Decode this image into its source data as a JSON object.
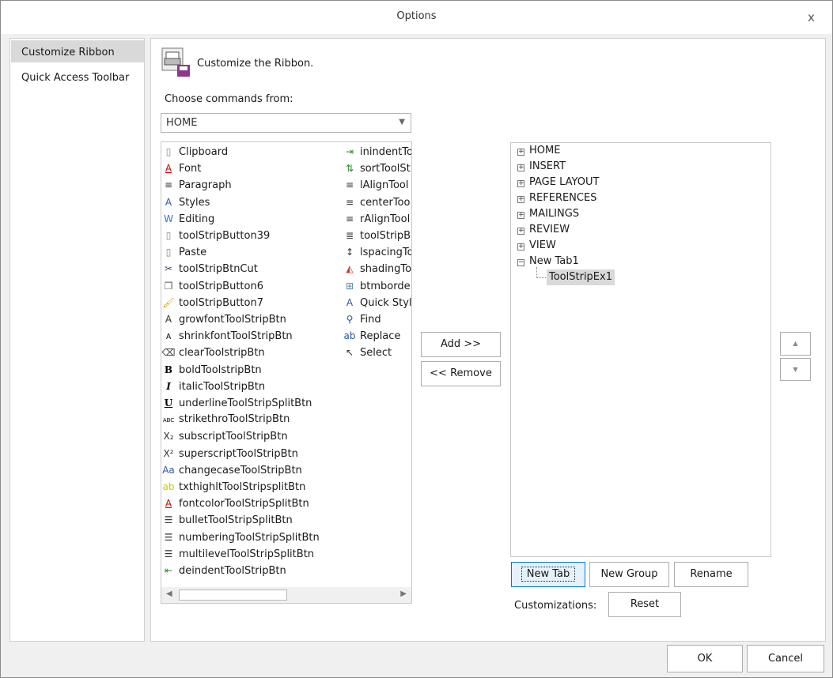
{
  "window": {
    "title": "Options",
    "close": "x"
  },
  "sidebar": {
    "items": [
      {
        "label": "Customize Ribbon",
        "selected": true
      },
      {
        "label": "Quick Access Toolbar",
        "selected": false
      }
    ]
  },
  "header": {
    "title": "Customize the Ribbon.",
    "icon": "customize-ribbon-icon"
  },
  "choose": {
    "label": "Choose commands from:",
    "value": "HOME"
  },
  "commands_col1": [
    {
      "label": "Clipboard",
      "icon": "clipboard"
    },
    {
      "label": "Font",
      "icon": "font"
    },
    {
      "label": "Paragraph",
      "icon": "paragraph"
    },
    {
      "label": "Styles",
      "icon": "styles"
    },
    {
      "label": "Editing",
      "icon": "editing"
    },
    {
      "label": "toolStripButton39",
      "icon": "clipboard"
    },
    {
      "label": "Paste",
      "icon": "clipboard"
    },
    {
      "label": "toolStripBtnCut",
      "icon": "cut"
    },
    {
      "label": "toolStripButton6",
      "icon": "copy"
    },
    {
      "label": "toolStripButton7",
      "icon": "format-painter"
    },
    {
      "label": "growfontToolStripBtn",
      "icon": "grow-font"
    },
    {
      "label": "shrinkfontToolStripBtn",
      "icon": "shrink-font"
    },
    {
      "label": "clearToolstripBtn",
      "icon": "clear-format"
    },
    {
      "label": "boldToolstripBtn",
      "icon": "bold"
    },
    {
      "label": "italicToolStripBtn",
      "icon": "italic"
    },
    {
      "label": "underlineToolStripSplitBtn",
      "icon": "underline"
    },
    {
      "label": "strikethroToolStripBtn",
      "icon": "strikethrough"
    },
    {
      "label": "subscriptToolStripBtn",
      "icon": "subscript"
    },
    {
      "label": "superscriptToolStripBtn",
      "icon": "superscript"
    },
    {
      "label": "changecaseToolStripBtn",
      "icon": "change-case"
    },
    {
      "label": "txthighltToolStripsplitBtn",
      "icon": "highlight"
    },
    {
      "label": "fontcolorToolStripSplitBtn",
      "icon": "font-color"
    },
    {
      "label": "bulletToolStripSplitBtn",
      "icon": "bullets"
    },
    {
      "label": "numberingToolStripSplitBtn",
      "icon": "numbering"
    },
    {
      "label": "multilevelToolStripSplitBtn",
      "icon": "multilevel"
    },
    {
      "label": "deindentToolStripBtn",
      "icon": "decrease-indent"
    }
  ],
  "commands_col2": [
    {
      "label": "inindentTo",
      "icon": "increase-indent"
    },
    {
      "label": "sortToolSt",
      "icon": "sort"
    },
    {
      "label": "lAlignTool",
      "icon": "align-left"
    },
    {
      "label": "centerToo",
      "icon": "align-center"
    },
    {
      "label": "rAlignTool",
      "icon": "align-right"
    },
    {
      "label": "toolStripB",
      "icon": "justify"
    },
    {
      "label": "lspacingTo",
      "icon": "line-spacing"
    },
    {
      "label": "shadingTo",
      "icon": "shading"
    },
    {
      "label": "btmborde",
      "icon": "borders"
    },
    {
      "label": "Quick Styl",
      "icon": "styles"
    },
    {
      "label": "Find",
      "icon": "find"
    },
    {
      "label": "Replace",
      "icon": "replace"
    },
    {
      "label": "Select",
      "icon": "select"
    }
  ],
  "buttons": {
    "add": "Add >>",
    "remove": "<< Remove",
    "new_tab": "New Tab",
    "new_group": "New Group",
    "rename": "Rename",
    "reset": "Reset",
    "ok": "OK",
    "cancel": "Cancel",
    "up": "▲",
    "down": "▼"
  },
  "customizations_label": "Customizations:",
  "tree": {
    "tabs": [
      {
        "label": "HOME",
        "expander": "+"
      },
      {
        "label": "INSERT",
        "expander": "+"
      },
      {
        "label": "PAGE LAYOUT",
        "expander": "+"
      },
      {
        "label": "REFERENCES",
        "expander": "+"
      },
      {
        "label": "MAILINGS",
        "expander": "+"
      },
      {
        "label": "REVIEW",
        "expander": "+"
      },
      {
        "label": "VIEW",
        "expander": "+"
      },
      {
        "label": "New Tab1",
        "expander": "−"
      }
    ],
    "child": "ToolStripEx1"
  },
  "colors": {
    "accent": "#0078d7",
    "selected": "#d9d9d9"
  }
}
